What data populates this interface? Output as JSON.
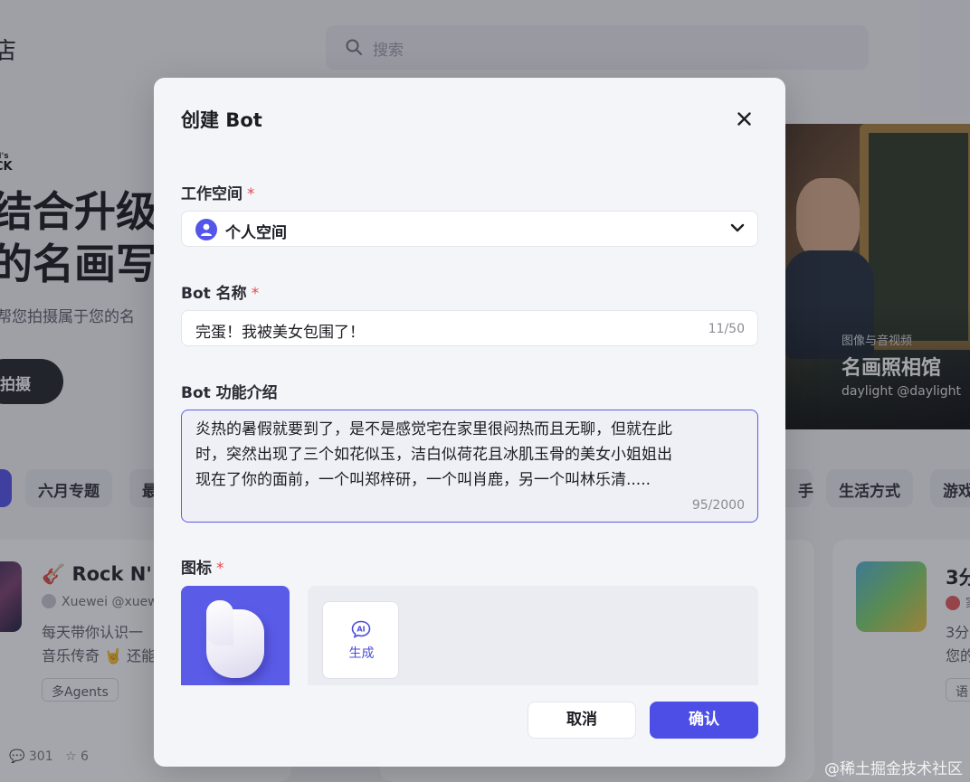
{
  "background": {
    "page_title": "店",
    "search_placeholder": "搜索",
    "hero": {
      "small_text_1": "N's",
      "small_text_2": "CK",
      "headline_1": "结合升级",
      "headline_2": "的名画写真",
      "subtitle": "帮您拍摄属于您的名",
      "button": "拍摄"
    },
    "banner": {
      "category": "图像与音视频",
      "name": "名画照相馆",
      "author": "daylight @daylight"
    },
    "tabs": [
      "六月专题",
      "最",
      "手",
      "生活方式",
      "游戏"
    ],
    "cards": [
      {
        "title": "🎸 Rock N'",
        "author": "Xuewei @xuew",
        "desc_1": "每天带你认识一",
        "desc_2": "音乐传奇 🤘 还能",
        "tag": "多Agents",
        "comments": "301",
        "stars": "6"
      },
      {
        "title": "3分",
        "author": "家",
        "desc_1": "3分",
        "desc_2": "您的",
        "tag": "语"
      }
    ],
    "colors": {
      "accent": "#4d4ee6",
      "overlay": "rgba(40,42,55,0.42)"
    }
  },
  "watermark": "@稀土掘金技术社区",
  "modal": {
    "title": "创建 Bot",
    "close_icon": "close-icon",
    "workspace": {
      "label": "工作空间",
      "required": "*",
      "value": "个人空间",
      "icon": "user-icon"
    },
    "bot_name": {
      "label": "Bot 名称",
      "required": "*",
      "value": "完蛋！我被美女包围了！",
      "counter": "11/50"
    },
    "bot_description": {
      "label": "Bot 功能介绍",
      "value": "炎热的暑假就要到了，是不是感觉宅在家里很闷热而且无聊，但就在此时，突然出现了三个如花似玉，洁白似荷花且冰肌玉骨的美女小姐姐出现在了你的面前，一个叫郑梓研，一个叫肖鹿，另一个叫林乐清.....",
      "counter": "95/2000"
    },
    "icon_section": {
      "label": "图标",
      "required": "*",
      "ai_generate_label": "生成",
      "ai_icon": "ai-sparkle-icon"
    },
    "buttons": {
      "cancel": "取消",
      "confirm": "确认"
    }
  }
}
